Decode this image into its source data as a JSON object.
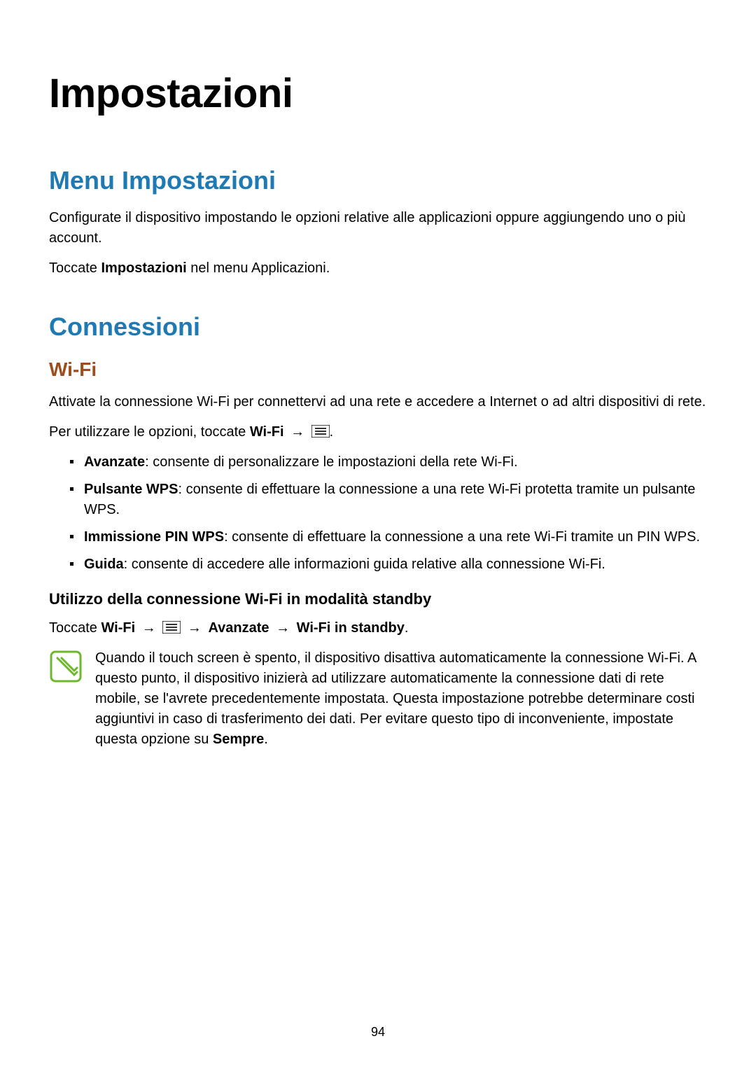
{
  "page_number": "94",
  "h1": "Impostazioni",
  "section1": {
    "title": "Menu Impostazioni",
    "p1": "Configurate il dispositivo impostando le opzioni relative alle applicazioni oppure aggiungendo uno o più account.",
    "p2_a": "Toccate ",
    "p2_b": "Impostazioni",
    "p2_c": " nel menu Applicazioni."
  },
  "section2": {
    "title": "Connessioni",
    "sub1": {
      "title": "Wi-Fi",
      "p1": "Attivate la connessione Wi-Fi per connettervi ad una rete e accedere a Internet o ad altri dispositivi di rete.",
      "p2_a": "Per utilizzare le opzioni, toccate ",
      "p2_b": "Wi-Fi",
      "arrow": "→",
      "p2_c": ".",
      "bullets": [
        {
          "b": "Avanzate",
          "t": ": consente di personalizzare le impostazioni della rete Wi-Fi."
        },
        {
          "b": "Pulsante WPS",
          "t": ": consente di effettuare la connessione a una rete Wi-Fi protetta tramite un pulsante WPS."
        },
        {
          "b": "Immissione PIN WPS",
          "t": ": consente di effettuare la connessione a una rete Wi-Fi tramite un PIN WPS."
        },
        {
          "b": "Guida",
          "t": ": consente di accedere alle informazioni guida relative alla connessione Wi-Fi."
        }
      ],
      "sub2": {
        "title": "Utilizzo della connessione Wi-Fi in modalità standby",
        "seq_a": "Toccate ",
        "seq_b": "Wi-Fi",
        "seq_c": "Avanzate",
        "seq_d": "Wi-Fi in standby",
        "seq_e": ".",
        "note_a": "Quando il touch screen è spento, il dispositivo disattiva automaticamente la connessione Wi-Fi. A questo punto, il dispositivo inizierà ad utilizzare automaticamente la connessione dati di rete mobile, se l'avrete precedentemente impostata. Questa impostazione potrebbe determinare costi aggiuntivi in caso di trasferimento dei dati. Per evitare questo tipo di inconveniente, impostate questa opzione su ",
        "note_b": "Sempre",
        "note_c": "."
      }
    }
  }
}
